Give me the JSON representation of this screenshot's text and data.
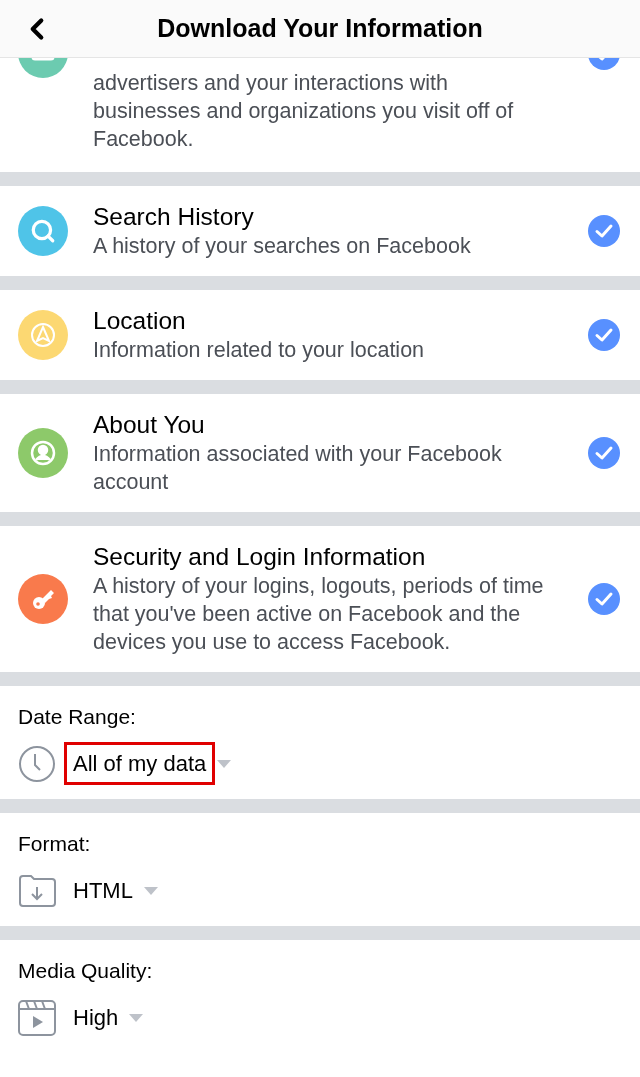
{
  "header": {
    "title": "Download Your Information"
  },
  "categories": [
    {
      "kind": "ads",
      "description": "advertisers and your interactions with businesses and organizations you visit off of Facebook.",
      "checked": true,
      "color": "#6ccbb0"
    },
    {
      "kind": "search",
      "title": "Search History",
      "description": "A history of your searches on Facebook",
      "checked": true,
      "color": "#4fc4e8"
    },
    {
      "kind": "location",
      "title": "Location",
      "description": "Information related to your location",
      "checked": true,
      "color": "#fcd872"
    },
    {
      "kind": "person",
      "title": "About You",
      "description": "Information associated with your Facebook account",
      "checked": true,
      "color": "#8dc96a"
    },
    {
      "kind": "key",
      "title": "Security and Login Information",
      "description": "A history of your logins, logouts, periods of time that you've been active on Facebook and the devices you use to access Facebook.",
      "checked": true,
      "color": "#f97a4c"
    }
  ],
  "options": [
    {
      "kind": "clock",
      "label": "Date Range:",
      "value": "All of my data",
      "highlighted": true
    },
    {
      "kind": "folder",
      "label": "Format:",
      "value": "HTML",
      "highlighted": false
    },
    {
      "kind": "video",
      "label": "Media Quality:",
      "value": "High",
      "highlighted": false
    }
  ]
}
